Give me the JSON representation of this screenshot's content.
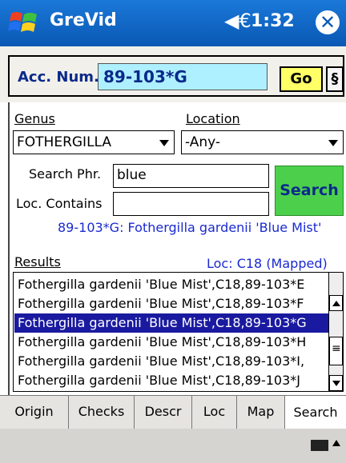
{
  "title_bar": {
    "app_title": "GreVid",
    "time": "1:32"
  },
  "accession": {
    "label": "Acc. Num.",
    "value": "89-103*G",
    "go_label": "Go",
    "section_label": "§"
  },
  "filters": {
    "genus_label": "Genus",
    "genus_value": "FOTHERGILLA",
    "location_label": "Location",
    "location_value": "-Any-",
    "search_phrase_label": "Search Phr.",
    "search_phrase_value": "blue",
    "loc_contains_label": "Loc. Contains",
    "loc_contains_value": "",
    "search_button": "Search"
  },
  "info_line": "89-103*G: Fothergilla gardenii 'Blue Mist'",
  "results": {
    "label": "Results",
    "loc_status": "Loc: C18 (Mapped)",
    "rows": [
      "Fothergilla gardenii 'Blue Mist',C18,89-103*E",
      "Fothergilla gardenii 'Blue Mist',C18,89-103*F",
      "Fothergilla gardenii 'Blue Mist',C18,89-103*G",
      "Fothergilla gardenii 'Blue Mist',C18,89-103*H",
      "Fothergilla gardenii 'Blue Mist',C18,89-103*I,",
      "Fothergilla gardenii 'Blue Mist',C18,89-103*J"
    ],
    "selected_index": 2
  },
  "tabs": [
    "Origin",
    "Checks",
    "Descr",
    "Loc",
    "Map",
    "Search"
  ],
  "active_tab": "Search"
}
